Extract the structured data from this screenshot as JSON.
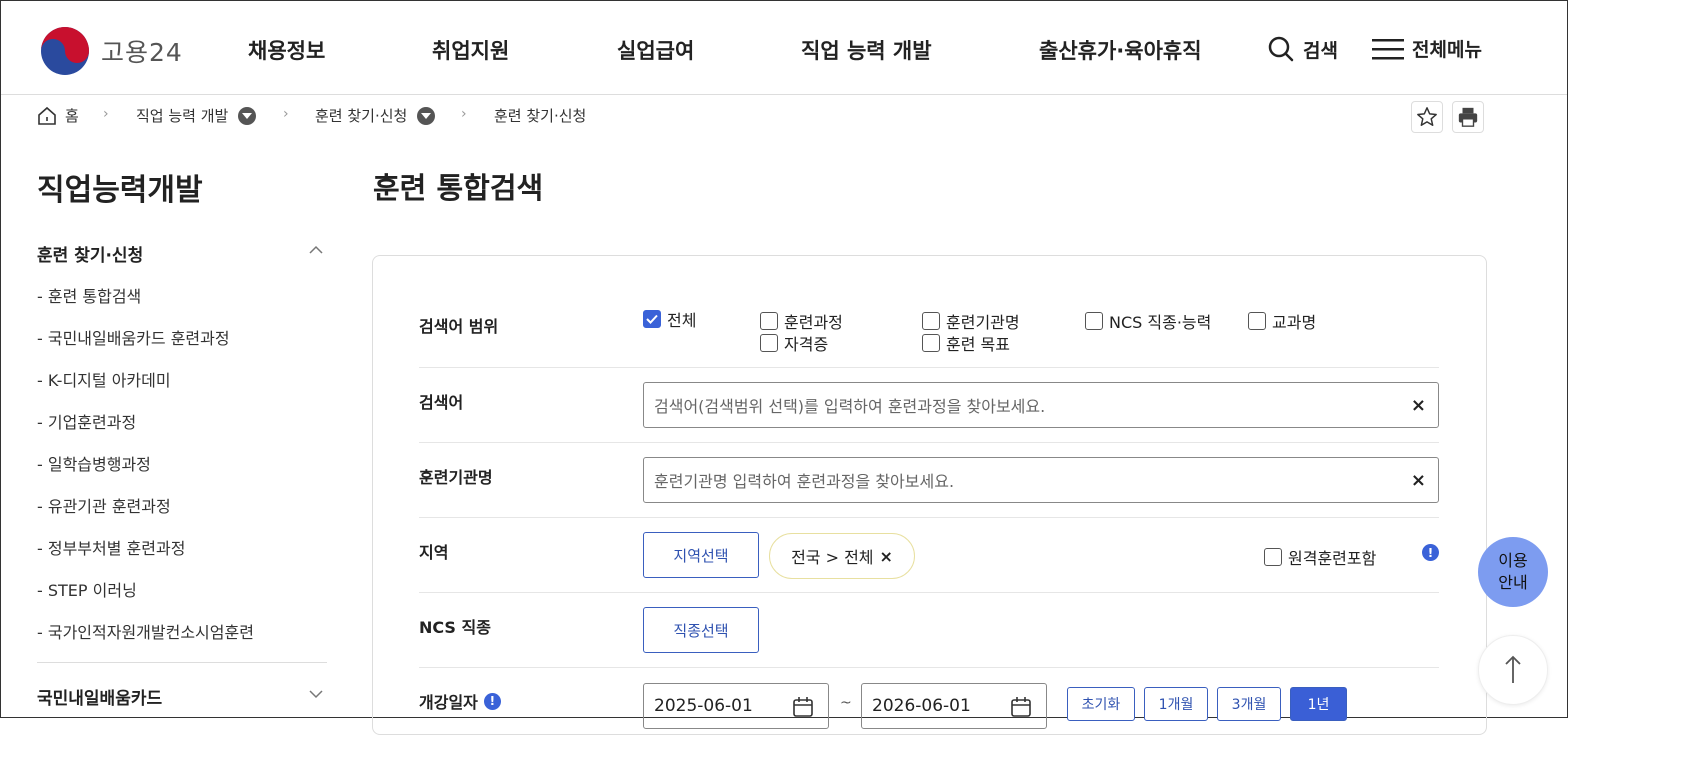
{
  "header": {
    "logo_text": "고용24",
    "nav": [
      "채용정보",
      "취업지원",
      "실업급여",
      "직업 능력 개발",
      "출산휴가·육아휴직"
    ],
    "search_label": "검색",
    "menu_label": "전체메뉴"
  },
  "breadcrumb": {
    "home": "홈",
    "level1": "직업 능력 개발",
    "level2": "훈련 찾기·신청",
    "level3": "훈련 찾기·신청"
  },
  "sidebar": {
    "title": "직업능력개발",
    "group1": "훈련 찾기·신청",
    "items": [
      "- 훈련 통합검색",
      "- 국민내일배움카드 훈련과정",
      "- K-디지털 아카데미",
      "- 기업훈련과정",
      "- 일학습병행과정",
      "- 유관기관 훈련과정",
      "- 정부부처별 훈련과정",
      "- STEP 이러닝",
      "- 국가인적자원개발컨소시엄훈련"
    ],
    "group2": "국민내일배움카드"
  },
  "main": {
    "title": "훈련 통합검색",
    "scope": {
      "label": "검색어 범위",
      "options": [
        "전체",
        "훈련과정",
        "훈련기관명",
        "NCS 직종·능력",
        "교과명",
        "자격증",
        "훈련 목표"
      ]
    },
    "keyword": {
      "label": "검색어",
      "placeholder": "검색어(검색범위 선택)를 입력하여 훈련과정을 찾아보세요.",
      "clear": "×"
    },
    "institution": {
      "label": "훈련기관명",
      "placeholder": "훈련기관명 입력하여 훈련과정을 찾아보세요.",
      "clear": "×"
    },
    "region": {
      "label": "지역",
      "button": "지역선택",
      "chip": "전국 > 전체",
      "chip_close": "×",
      "remote": "원격훈련포함"
    },
    "ncs": {
      "label": "NCS 직종",
      "button": "직종선택"
    },
    "date": {
      "label": "개강일자",
      "start": "2025-06-01",
      "tilde": "~",
      "end": "2026-06-01",
      "ranges": [
        "초기화",
        "1개월",
        "3개월",
        "1년"
      ]
    }
  },
  "floating": {
    "guide_line1": "이용",
    "guide_line2": "안내"
  },
  "colors": {
    "accent": "#3a62d8",
    "guide": "#7d9cf0"
  }
}
